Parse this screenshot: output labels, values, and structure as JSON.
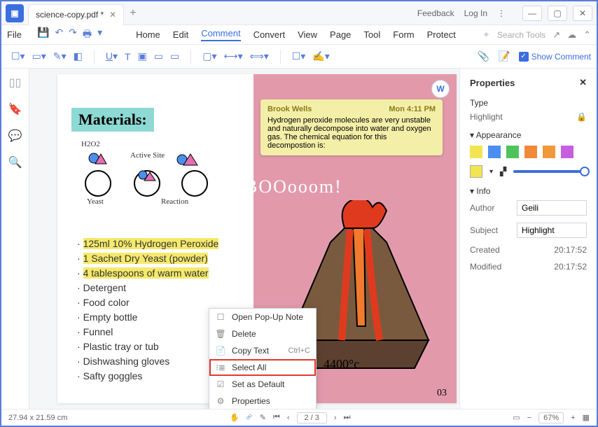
{
  "titlebar": {
    "tab_title": "science-copy.pdf *",
    "feedback": "Feedback",
    "login": "Log In"
  },
  "menubar": {
    "file": "File",
    "tabs": [
      "Home",
      "Edit",
      "Comment",
      "Convert",
      "View",
      "Page",
      "Tool",
      "Form",
      "Protect"
    ],
    "active_tab": "Comment",
    "search_placeholder": "Search Tools"
  },
  "toolbar": {
    "show_comment": "Show Comment"
  },
  "document": {
    "materials_title": "Materials:",
    "diagram_labels": {
      "h2o2": "H2O2",
      "active_site": "Active Site",
      "yeast": "Yeast",
      "reaction": "Reaction"
    },
    "highlighted": [
      "125ml 10% Hydrogen Peroxide",
      "1 Sachet Dry Yeast (powder)",
      "4 tablespoons of warm water"
    ],
    "plain": [
      "Detergent",
      "Food color",
      "Empty bottle",
      "Funnel",
      "Plastic tray or tub",
      "Dishwashing gloves",
      "Safty goggles"
    ],
    "boom": "BOOooom!",
    "temp": "4400°c",
    "page_number": "03",
    "note": {
      "author": "Brook Wells",
      "time": "Mon 4:11 PM",
      "body": "Hydrogen peroxide molecules are very unstable and naturally decompose into water and oxygen gas. The chemical equation for this decompostion is:"
    }
  },
  "context_menu": {
    "items": [
      {
        "icon": "☐",
        "label": "Open Pop-Up Note",
        "shortcut": ""
      },
      {
        "icon": "🗑",
        "label": "Delete",
        "shortcut": ""
      },
      {
        "icon": "📄",
        "label": "Copy Text",
        "shortcut": "Ctrl+C"
      },
      {
        "icon": "⁝≣",
        "label": "Select All",
        "shortcut": ""
      },
      {
        "icon": "☑",
        "label": "Set as Default",
        "shortcut": ""
      },
      {
        "icon": "⚙",
        "label": "Properties",
        "shortcut": ""
      }
    ],
    "selected_index": 3
  },
  "properties": {
    "title": "Properties",
    "type_label": "Type",
    "type_value": "Highlight",
    "appearance_label": "Appearance",
    "swatches": [
      "#f3e551",
      "#4a8ff0",
      "#4fc35b",
      "#f08a3a",
      "#f0993a",
      "#c75ee0"
    ],
    "info_label": "Info",
    "author_label": "Author",
    "author_value": "Geili",
    "subject_label": "Subject",
    "subject_value": "Highlight",
    "created_label": "Created",
    "created_value": "20:17:52",
    "modified_label": "Modified",
    "modified_value": "20:17:52"
  },
  "statusbar": {
    "dimensions": "27.94 x 21.59 cm",
    "page": "2 / 3",
    "zoom": "67%"
  }
}
